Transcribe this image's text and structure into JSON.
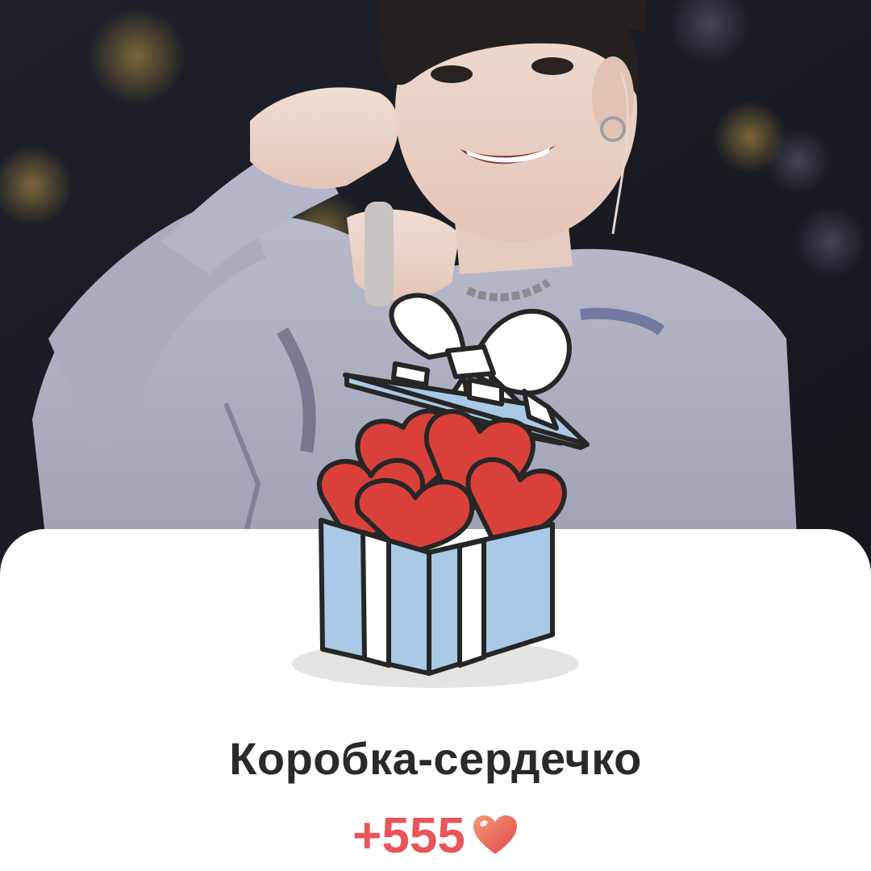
{
  "gift": {
    "title": "Коробка-сердечко",
    "reward": "+555",
    "reward_icon": "heart-icon",
    "box_icon": "gift-box-hearts-icon"
  },
  "colors": {
    "sheet_background": "#ffffff",
    "title_text": "#2a2a2a",
    "reward_text": "#e8555a",
    "box_stripe_blue": "#a9c9e6",
    "heart_red": "#d9403a"
  }
}
